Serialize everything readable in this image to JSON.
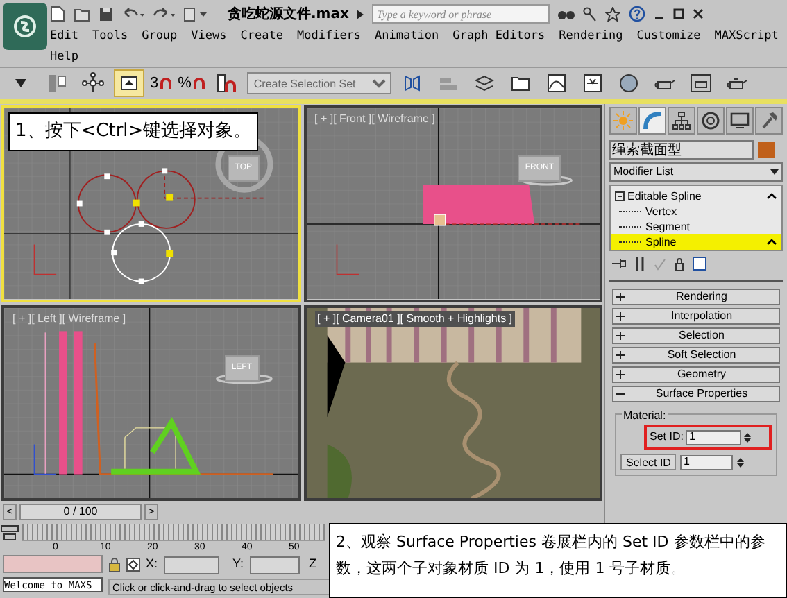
{
  "title_bar": {
    "title": "贪吃蛇源文件.max",
    "search": {
      "placeholder": "Type a keyword or phrase"
    }
  },
  "menu": [
    "Edit",
    "Tools",
    "Group",
    "Views",
    "Create",
    "Modifiers",
    "Animation",
    "Graph Editors",
    "Rendering",
    "Customize",
    "MAXScript",
    "Help"
  ],
  "toolbar": {
    "snap_labels": [
      "3",
      "%"
    ],
    "selection_set": "Create Selection Set"
  },
  "viewports": [
    {
      "kind": "top",
      "cube": "TOP",
      "selected": true
    },
    {
      "kind": "front",
      "label": "[ + ][ Front ][ Wireframe ]",
      "cube": "FRONT",
      "selected": false
    },
    {
      "kind": "left",
      "label": "[ + ][ Left ][ Wireframe ]",
      "cube": "LEFT",
      "selected": false
    },
    {
      "kind": "camera",
      "label": "[ + ][ Camera01 ][ Smooth + Highlights ]",
      "selected": false
    }
  ],
  "callouts": [
    "1、按下<Ctrl>键选择对象。",
    "2、观察 Surface Properties 卷展栏内的 Set ID 参数栏中的参数，这两个子对象材质 ID 为 1，使用 1 号子材质。"
  ],
  "command_panel": {
    "tabs": [
      {
        "kind": "create",
        "selected": false
      },
      {
        "kind": "modify",
        "selected": true
      },
      {
        "kind": "hierarchy",
        "selected": false
      },
      {
        "kind": "motion",
        "selected": false
      },
      {
        "kind": "display",
        "selected": false
      },
      {
        "kind": "utilities",
        "selected": false
      }
    ],
    "object_name": "绳索截面型",
    "modifier_list": "Modifier List",
    "stack": [
      {
        "label": "Editable Spline",
        "expanded": true,
        "selected": false,
        "children": [
          {
            "label": "Vertex",
            "selected": false
          },
          {
            "label": "Segment",
            "selected": false
          },
          {
            "label": "Spline",
            "selected": true
          }
        ]
      }
    ],
    "rollouts": [
      {
        "title": "Rendering",
        "expanded": false
      },
      {
        "title": "Interpolation",
        "expanded": false
      },
      {
        "title": "Selection",
        "expanded": false
      },
      {
        "title": "Soft Selection",
        "expanded": false
      },
      {
        "title": "Geometry",
        "expanded": false
      },
      {
        "title": "Surface Properties",
        "expanded": true
      }
    ],
    "material": {
      "group": "Material:",
      "set_id_label": "Set ID:",
      "set_id": "1",
      "select_id_button": "Select ID",
      "select_id": "1"
    }
  },
  "time_slider": {
    "prev": "<",
    "position": "0 / 100",
    "next": ">",
    "level": 0
  },
  "track_bar": {
    "ticks": [
      "0",
      "10",
      "20",
      "30",
      "40",
      "50"
    ]
  },
  "status_bar": {
    "welcome": "Welcome to MAXS",
    "prompt": "Click or click-and-drag to select objects",
    "x_label": "X:",
    "y_label": "Y:",
    "z_label": "Z"
  }
}
